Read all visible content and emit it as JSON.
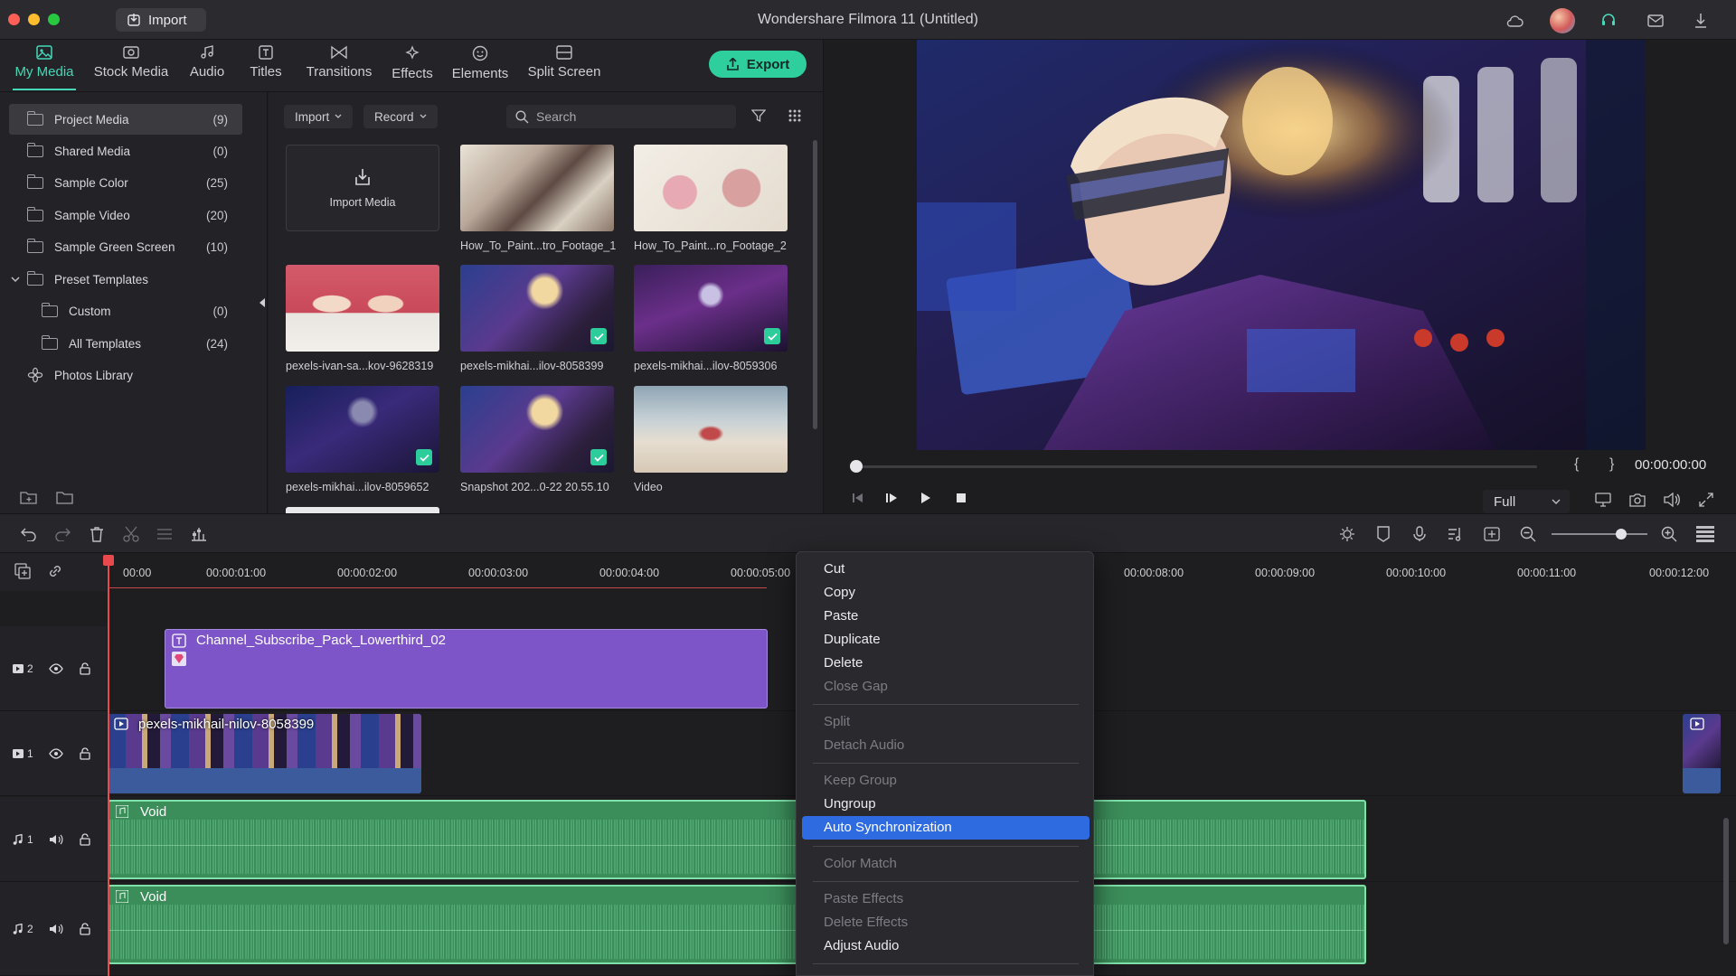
{
  "window": {
    "title": "Wondershare Filmora 11 (Untitled)",
    "import_label": "Import"
  },
  "library_tabs": [
    {
      "label": "My Media",
      "icon": "my-media-icon",
      "active": true
    },
    {
      "label": "Stock Media",
      "icon": "stock-media-icon"
    },
    {
      "label": "Audio",
      "icon": "music-note-icon"
    },
    {
      "label": "Titles",
      "icon": "titles-icon"
    },
    {
      "label": "Transitions",
      "icon": "transitions-icon"
    },
    {
      "label": "Effects",
      "icon": "effects-icon"
    },
    {
      "label": "Elements",
      "icon": "elements-icon"
    },
    {
      "label": "Split Screen",
      "icon": "split-screen-icon"
    }
  ],
  "export_label": "Export",
  "sidebar": {
    "items": [
      {
        "label": "Project Media",
        "count": "(9)",
        "selected": true
      },
      {
        "label": "Shared Media",
        "count": "(0)"
      },
      {
        "label": "Sample Color",
        "count": "(25)"
      },
      {
        "label": "Sample Video",
        "count": "(20)"
      },
      {
        "label": "Sample Green Screen",
        "count": "(10)"
      },
      {
        "label": "Preset Templates",
        "count": "",
        "expanded": true
      },
      {
        "label": "Custom",
        "count": "(0)",
        "child": true
      },
      {
        "label": "All Templates",
        "count": "(24)",
        "child": true
      },
      {
        "label": "Photos Library",
        "count": "",
        "icon": "photos-icon"
      }
    ]
  },
  "media_toolbar": {
    "import_dd": "Import",
    "record_dd": "Record",
    "search_placeholder": "Search"
  },
  "media": {
    "import_tile": "Import Media",
    "items": [
      {
        "label": "How_To_Paint...tro_Footage_1",
        "checked": false
      },
      {
        "label": "How_To_Paint...ro_Footage_2",
        "checked": false
      },
      {
        "label": "pexels-ivan-sa...kov-9628319",
        "checked": false
      },
      {
        "label": "pexels-mikhai...ilov-8058399",
        "checked": true
      },
      {
        "label": "pexels-mikhai...ilov-8059306",
        "checked": true
      },
      {
        "label": "pexels-mikhai...ilov-8059652",
        "checked": true
      },
      {
        "label": "Snapshot 202...0-22 20.55.10",
        "checked": true
      },
      {
        "label": "Video",
        "checked": false
      }
    ]
  },
  "preview": {
    "timecode": "00:00:00:00",
    "zoom": "Full",
    "mark_in": "{",
    "mark_out": "}"
  },
  "timeline": {
    "ruler": [
      "00:00",
      "00:00:01:00",
      "00:00:02:00",
      "00:00:03:00",
      "00:00:04:00",
      "00:00:05:00",
      "00:00:08:00",
      "00:00:09:00",
      "00:00:10:00",
      "00:00:11:00",
      "00:00:12:00"
    ],
    "tracks": [
      {
        "label": "2",
        "kind": "video"
      },
      {
        "label": "1",
        "kind": "video"
      },
      {
        "label": "1",
        "kind": "audio"
      },
      {
        "label": "2",
        "kind": "audio"
      }
    ],
    "clips": {
      "title_clip": "Channel_Subscribe_Pack_Lowerthird_02",
      "video_clip": "pexels-mikhail-nilov-8058399",
      "audio_clip_1": "Void",
      "audio_clip_2": "Void"
    },
    "zoom_level": 0.73
  },
  "context_menu": {
    "items": [
      {
        "label": "Cut",
        "enabled": true
      },
      {
        "label": "Copy",
        "enabled": true
      },
      {
        "label": "Paste",
        "enabled": true
      },
      {
        "label": "Duplicate",
        "enabled": true
      },
      {
        "label": "Delete",
        "enabled": true
      },
      {
        "label": "Close Gap",
        "enabled": false
      },
      {
        "label": "Split",
        "enabled": false
      },
      {
        "label": "Detach Audio",
        "enabled": false
      },
      {
        "label": "Keep Group",
        "enabled": false
      },
      {
        "label": "Ungroup",
        "enabled": true
      },
      {
        "label": "Auto Synchronization",
        "enabled": true,
        "highlighted": true
      },
      {
        "label": "Color Match",
        "enabled": false
      },
      {
        "label": "Paste Effects",
        "enabled": false
      },
      {
        "label": "Delete Effects",
        "enabled": false
      },
      {
        "label": "Adjust Audio",
        "enabled": true
      }
    ]
  },
  "colors": {
    "accent": "#44d8b8",
    "export": "#2fcf9d",
    "title_clip": "#7e55c9",
    "audio_clip": "#3b8d5a",
    "menu_highlight": "#2f6be0",
    "playhead": "#e8494c"
  }
}
